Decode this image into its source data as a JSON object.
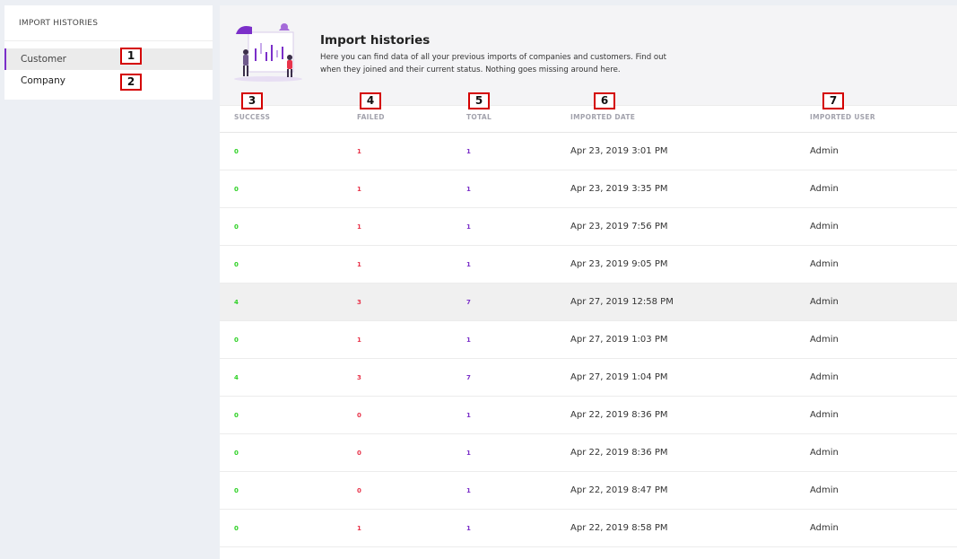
{
  "sidebar": {
    "title": "IMPORT HISTORIES",
    "items": [
      {
        "label": "Customer",
        "active": true
      },
      {
        "label": "Company",
        "active": false
      }
    ]
  },
  "markers": [
    "1",
    "2",
    "3",
    "4",
    "5",
    "6",
    "7"
  ],
  "header": {
    "title": "Import histories",
    "description": "Here you can find data of all your previous imports of companies and customers. Find out when they joined and their current status. Nothing goes missing around here.",
    "illustration_icon": "import-chart-illustration"
  },
  "table": {
    "columns": [
      "SUCCESS",
      "FAILED",
      "TOTAL",
      "IMPORTED DATE",
      "IMPORTED USER"
    ],
    "rows": [
      {
        "success": "0",
        "failed": "1",
        "total": "1",
        "date": "Apr 23, 2019 3:01 PM",
        "user": "Admin"
      },
      {
        "success": "0",
        "failed": "1",
        "total": "1",
        "date": "Apr 23, 2019 3:35 PM",
        "user": "Admin"
      },
      {
        "success": "0",
        "failed": "1",
        "total": "1",
        "date": "Apr 23, 2019 7:56 PM",
        "user": "Admin"
      },
      {
        "success": "0",
        "failed": "1",
        "total": "1",
        "date": "Apr 23, 2019 9:05 PM",
        "user": "Admin"
      },
      {
        "success": "4",
        "failed": "3",
        "total": "7",
        "date": "Apr 27, 2019 12:58 PM",
        "user": "Admin"
      },
      {
        "success": "0",
        "failed": "1",
        "total": "1",
        "date": "Apr 27, 2019 1:03 PM",
        "user": "Admin"
      },
      {
        "success": "4",
        "failed": "3",
        "total": "7",
        "date": "Apr 27, 2019 1:04 PM",
        "user": "Admin"
      },
      {
        "success": "0",
        "failed": "0",
        "total": "1",
        "date": "Apr 22, 2019 8:36 PM",
        "user": "Admin"
      },
      {
        "success": "0",
        "failed": "0",
        "total": "1",
        "date": "Apr 22, 2019 8:36 PM",
        "user": "Admin"
      },
      {
        "success": "0",
        "failed": "0",
        "total": "1",
        "date": "Apr 22, 2019 8:47 PM",
        "user": "Admin"
      },
      {
        "success": "0",
        "failed": "1",
        "total": "1",
        "date": "Apr 22, 2019 8:58 PM",
        "user": "Admin"
      }
    ]
  },
  "colors": {
    "accent": "#7b2fc9",
    "success": "#2fd126",
    "failed": "#e8334a",
    "marker_border": "#d40000"
  }
}
